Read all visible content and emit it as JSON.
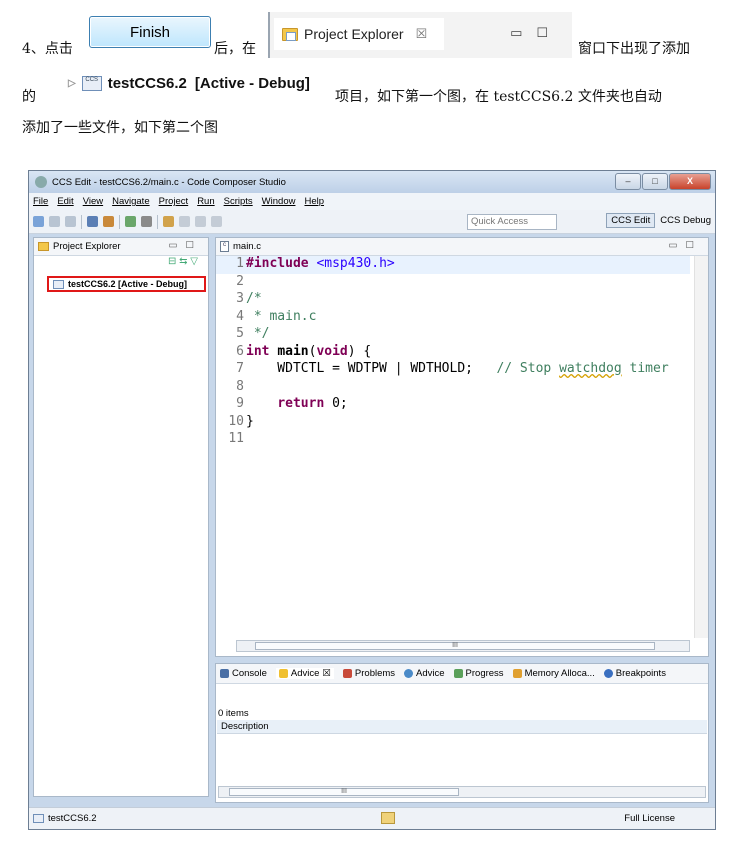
{
  "doc": {
    "line1_prefix": "4、点击",
    "finish_label": "Finish",
    "line1_mid": "后，在",
    "tab_label": "Project Explorer",
    "tab_close": "☒",
    "line1_suffix": "窗口下出现了添加",
    "line2_prefix": "的",
    "project_name": "testCCS6.2",
    "project_state": "[Active - Debug]",
    "line2_suffix": "项目，如下第一个图，在 testCCS6.2 文件夹也自动",
    "line3": "添加了一些文件，如下第二个图"
  },
  "screenshot": {
    "title": "CCS Edit - testCCS6.2/main.c - Code Composer Studio",
    "menu": [
      "File",
      "Edit",
      "View",
      "Navigate",
      "Project",
      "Run",
      "Scripts",
      "Window",
      "Help"
    ],
    "quick_access": "Quick Access",
    "perspectives": [
      "CCS Edit",
      "CCS Debug"
    ],
    "explorer_tab": "Project Explorer",
    "tree_item": "testCCS6.2  [Active - Debug]",
    "editor_tab": "main.c",
    "code_lines": [
      {
        "n": "1",
        "html": "<span class=\"kw\">#include</span> <span class=\"str\">&lt;msp430.h&gt;</span>"
      },
      {
        "n": "2",
        "html": ""
      },
      {
        "n": "3",
        "html": "<span class=\"cm\">/*</span>"
      },
      {
        "n": "4",
        "html": "<span class=\"cm\"> * main.c</span>"
      },
      {
        "n": "5",
        "html": "<span class=\"cm\"> */</span>"
      },
      {
        "n": "6",
        "html": "<span class=\"kw\">int</span> <b>main</b>(<span class=\"kw\">void</span>) {"
      },
      {
        "n": "7",
        "html": "    WDTCTL = WDTPW | WDTHOLD;   <span class=\"cm\">// Stop <span class=\"squig\">watchdog</span> timer</span>"
      },
      {
        "n": "8",
        "html": ""
      },
      {
        "n": "9",
        "html": "    <span class=\"kw\">return</span> 0;"
      },
      {
        "n": "10",
        "html": "}"
      },
      {
        "n": "11",
        "html": ""
      }
    ],
    "bottom_tabs": [
      "Console",
      "Advice",
      "Problems",
      "Advice",
      "Progress",
      "Memory Alloca...",
      "Breakpoints"
    ],
    "items_count": "0 items",
    "description_header": "Description",
    "status_project": "testCCS6.2",
    "status_license": "Full License",
    "hscroll_mark": "III",
    "win_buttons": [
      "–",
      "□",
      "X"
    ]
  }
}
